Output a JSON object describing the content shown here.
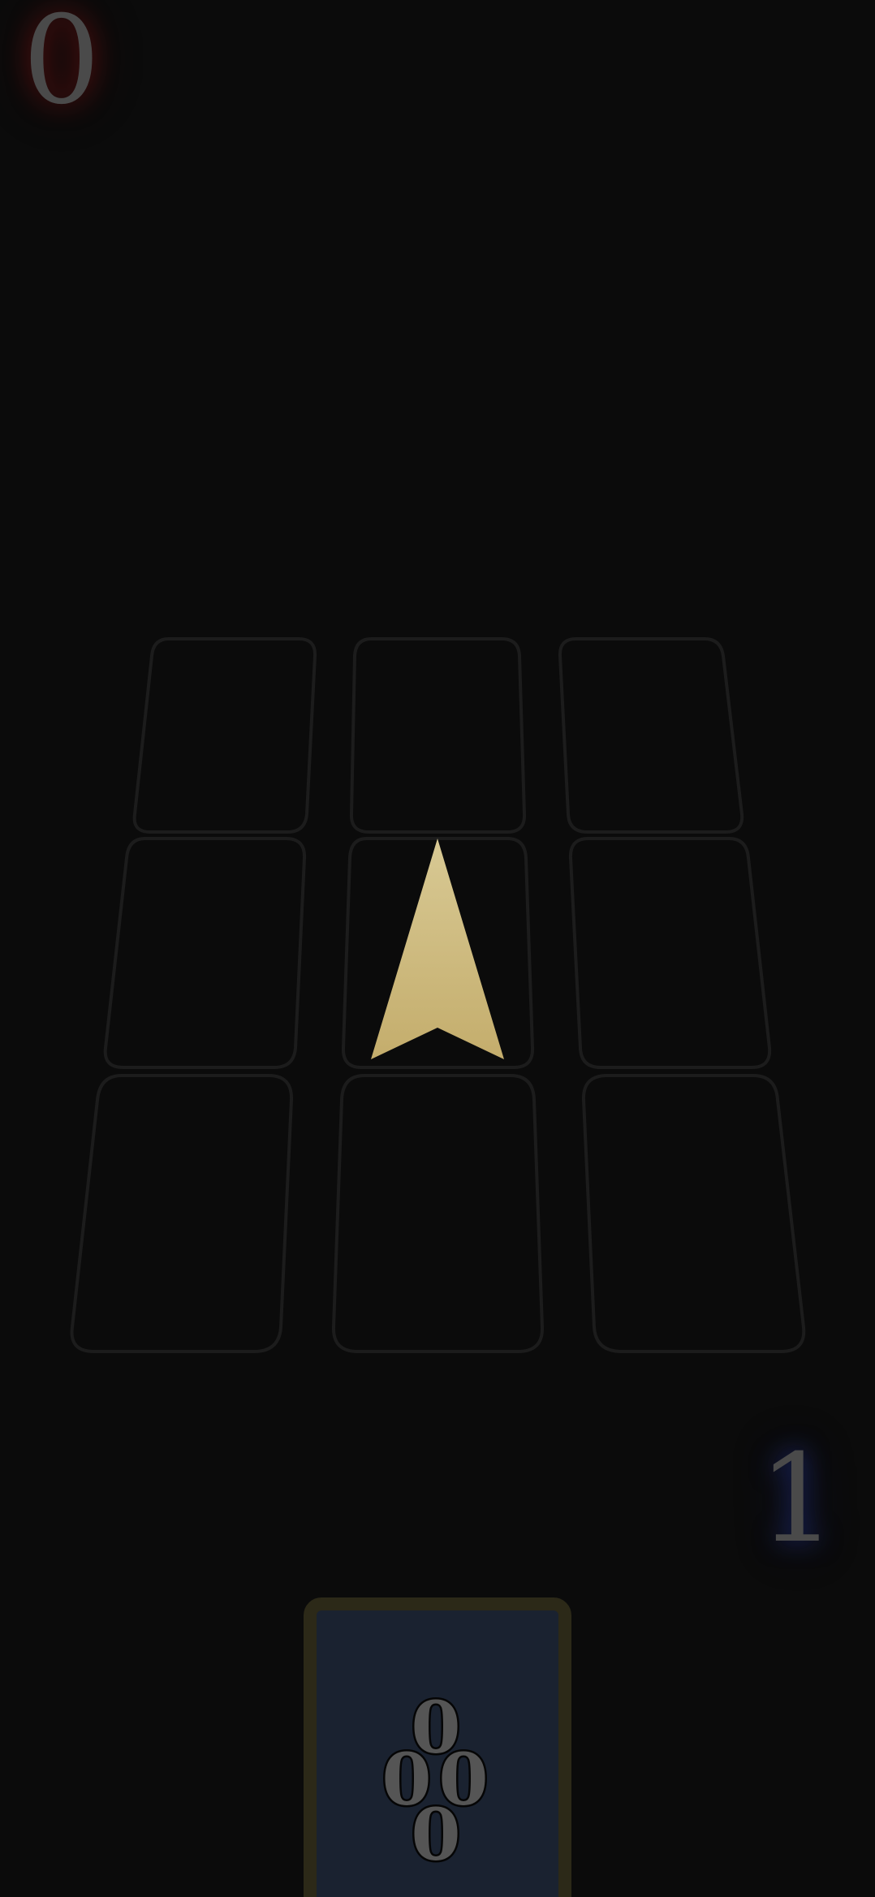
{
  "scores": {
    "top_player": "0",
    "bottom_player": "1"
  },
  "colors": {
    "background": "#0b0b0b",
    "slot_outline": "#1c1c1c",
    "top_player_glow": "#961414",
    "bottom_player_glow": "#283caa",
    "arrow_light": "#d8c994",
    "arrow_dark": "#c4ad6c",
    "hand_card_border": "#2c2918",
    "hand_card_face": "#1a2230"
  },
  "board": {
    "rows": 3,
    "cols": 3,
    "occupied_cells": []
  },
  "turn_indicator": {
    "icon": "turn-arrow-icon",
    "direction": "up",
    "cell": "center"
  },
  "hand_card": {
    "values": {
      "top": "0",
      "left": "0",
      "right": "0",
      "bottom": "0"
    }
  }
}
